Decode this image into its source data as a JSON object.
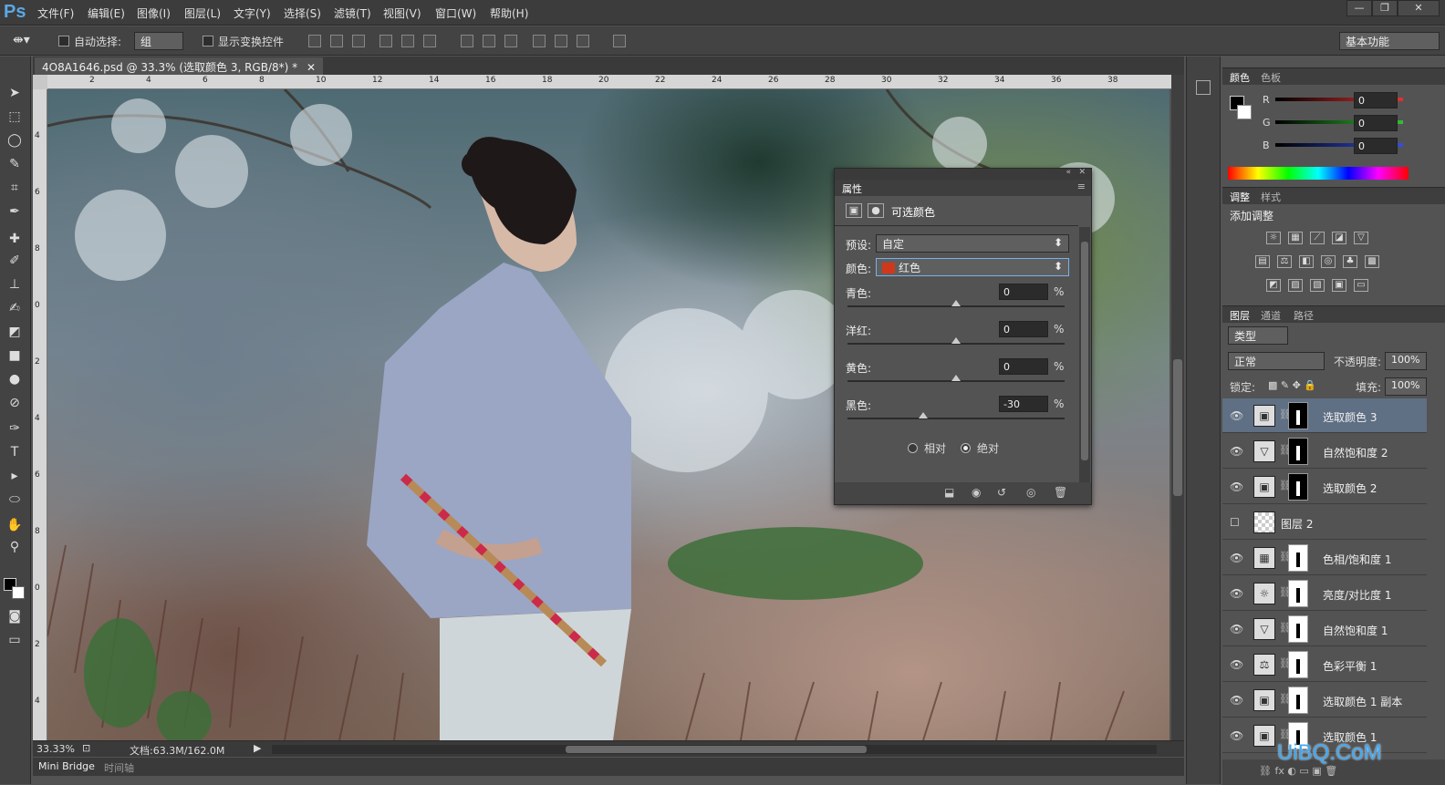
{
  "app": {
    "logo": "Ps"
  },
  "menu": [
    "文件(F)",
    "编辑(E)",
    "图像(I)",
    "图层(L)",
    "文字(Y)",
    "选择(S)",
    "滤镜(T)",
    "视图(V)",
    "窗口(W)",
    "帮助(H)"
  ],
  "window_controls": {
    "minimize": "—",
    "restore": "❐",
    "close": "✕"
  },
  "options": {
    "auto_select_label": "自动选择:",
    "auto_select_value": "组",
    "show_transform_label": "显示变换控件",
    "workspace": "基本功能"
  },
  "document": {
    "tab_title": "4O8A1646.psd @ 33.3% (选取颜色 3, RGB/8*) *",
    "zoom": "33.33%",
    "doc_info": "文档:63.3M/162.0M"
  },
  "ruler": {
    "top": [
      "2",
      "4",
      "6",
      "8",
      "10",
      "12",
      "14",
      "16",
      "18",
      "20",
      "22",
      "24",
      "26",
      "28",
      "30",
      "32",
      "34",
      "36",
      "38"
    ],
    "left": [
      "4",
      "6",
      "8",
      "0",
      "2",
      "4",
      "6",
      "8",
      "0",
      "2",
      "4"
    ]
  },
  "bottom_tabs": [
    "Mini Bridge",
    "时间轴"
  ],
  "color_panel": {
    "tabs": [
      "颜色",
      "色板"
    ],
    "channels": [
      {
        "label": "R",
        "value": "0",
        "color": "#e53030"
      },
      {
        "label": "G",
        "value": "0",
        "color": "#30c030"
      },
      {
        "label": "B",
        "value": "0",
        "color": "#3050e5"
      }
    ]
  },
  "adjust_panel": {
    "tabs": [
      "调整",
      "样式"
    ],
    "title": "添加调整"
  },
  "layers_panel": {
    "tabs": [
      "图层",
      "通道",
      "路径"
    ],
    "filter": "类型",
    "blend_mode": "正常",
    "opacity_label": "不透明度:",
    "opacity": "100%",
    "lock_label": "锁定:",
    "fill_label": "填充:",
    "fill": "100%",
    "layers": [
      {
        "name": "选取颜色 3",
        "icon": "▣",
        "visible": true,
        "selected": true,
        "mask": "black"
      },
      {
        "name": "自然饱和度 2",
        "icon": "▽",
        "visible": true,
        "mask": "black"
      },
      {
        "name": "选取颜色 2",
        "icon": "▣",
        "visible": true,
        "mask": "black"
      },
      {
        "name": "图层 2",
        "icon": "",
        "visible": false,
        "mask": "none"
      },
      {
        "name": "色相/饱和度 1",
        "icon": "▦",
        "visible": true,
        "mask": "white"
      },
      {
        "name": "亮度/对比度 1",
        "icon": "☼",
        "visible": true,
        "mask": "white"
      },
      {
        "name": "自然饱和度 1",
        "icon": "▽",
        "visible": true,
        "mask": "white"
      },
      {
        "name": "色彩平衡 1",
        "icon": "⚖",
        "visible": true,
        "mask": "white"
      },
      {
        "name": "选取颜色 1 副本",
        "icon": "▣",
        "visible": true,
        "mask": "white"
      },
      {
        "name": "选取颜色 1",
        "icon": "▣",
        "visible": true,
        "mask": "white"
      }
    ]
  },
  "properties": {
    "tab": "属性",
    "title": "可选颜色",
    "preset_label": "预设:",
    "preset": "自定",
    "color_label": "颜色:",
    "color": "红色",
    "swatch": "#d0381c",
    "sliders": [
      {
        "label": "青色:",
        "value": "0",
        "pct": "%",
        "pos": 0.5
      },
      {
        "label": "洋红:",
        "value": "0",
        "pct": "%",
        "pos": 0.5
      },
      {
        "label": "黄色:",
        "value": "0",
        "pct": "%",
        "pos": 0.5
      },
      {
        "label": "黑色:",
        "value": "-30",
        "pct": "%",
        "pos": 0.35
      }
    ],
    "method_relative": "相对",
    "method_absolute": "绝对"
  },
  "watermark": "UiBQ.CoM"
}
